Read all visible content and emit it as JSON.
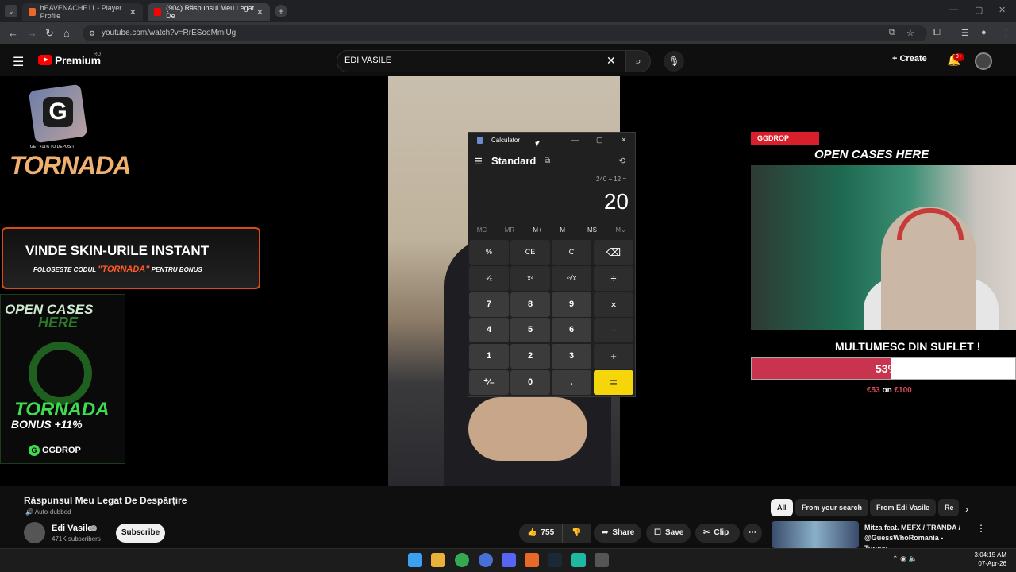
{
  "browser": {
    "tabs": [
      {
        "label": "hEAVENACHE11 - Player Profile",
        "active": false
      },
      {
        "label": "(904) Răspunsul Meu Legat De",
        "active": true
      }
    ],
    "url": "youtube.com/watch?v=RrESooMmiUg"
  },
  "youtube": {
    "logo_text": "Premium",
    "region": "RO",
    "search_value": "EDI VASILE",
    "create_label": "Create",
    "notification_count": "9+"
  },
  "overlays": {
    "left": {
      "deposit_text": "GET +11% TO DEPOSIT",
      "tornada_title": "TORNADA",
      "sell_title": "VINDE SKIN-URILE INSTANT",
      "sell_sub_prefix": "FOLOSESTE CODUL",
      "sell_code": "\"TORNADA\"",
      "sell_sub_suffix": "PENTRU BONUS",
      "open_cases": "OPEN CASES",
      "here": "HERE",
      "tornada_green": "TORNADA",
      "bonus": "BONUS +11%",
      "ggdrop": "GGDROP"
    },
    "right": {
      "ggdrop": "GGDROP",
      "open_cases": "OPEN CASES HERE",
      "thanks": "MULTUMESC DIN SUFLET !",
      "goal_percent_label": "53%",
      "goal_fraction": 0.53,
      "goal_raised": "€53",
      "goal_mid": "on",
      "goal_target": "€100"
    }
  },
  "calculator": {
    "window_title": "Calculator",
    "mode": "Standard",
    "expression": "240 ÷ 12 =",
    "result": "20",
    "memory": [
      "MC",
      "MR",
      "M+",
      "M−",
      "MS",
      "M⌄"
    ],
    "keys": [
      [
        "%",
        "CE",
        "C",
        "⌫"
      ],
      [
        "¹⁄ₓ",
        "x²",
        "²√x",
        "÷"
      ],
      [
        "7",
        "8",
        "9",
        "×"
      ],
      [
        "4",
        "5",
        "6",
        "−"
      ],
      [
        "1",
        "2",
        "3",
        "+"
      ],
      [
        "⁺⁄₋",
        "0",
        ".",
        "="
      ]
    ]
  },
  "video": {
    "title": "Răspunsul Meu Legat De Despărțire",
    "dub_label": "Auto-dubbed",
    "channel": "Edi Vasile",
    "subscribers": "471K subscribers",
    "subscribe_label": "Subscribe",
    "likes": "755",
    "share_label": "Share",
    "save_label": "Save",
    "clip_label": "Clip"
  },
  "related": {
    "chips": [
      "All",
      "From your search",
      "From Edi Vasile",
      "Re"
    ],
    "first_title": "Mitza feat. MEFX / TRANDA / @GuessWhoRomania - Torace"
  },
  "taskbar": {
    "time": "3:04:15 AM",
    "date": "07-Apr-26"
  },
  "colors": {
    "yt_red": "#ff0000",
    "calc_equals": "#f5d60a",
    "goal_fill": "#c8344e",
    "ggdrop_red": "#d81f2b"
  }
}
